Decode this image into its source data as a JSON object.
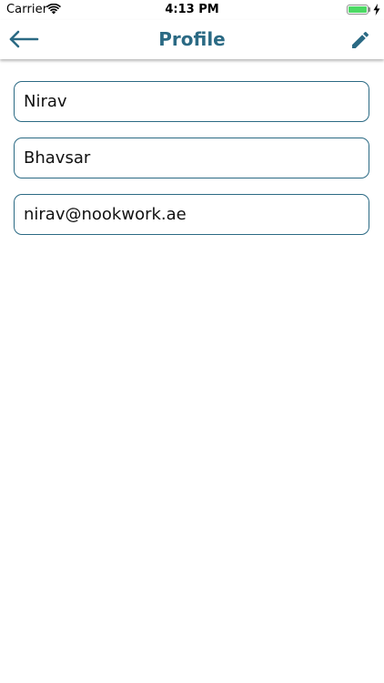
{
  "status_bar": {
    "carrier": "Carrier",
    "time": "4:13 PM",
    "battery_color": "#4cd964"
  },
  "nav": {
    "title": "Profile",
    "back_icon": "back-arrow-icon",
    "edit_icon": "pencil-icon",
    "accent_color": "#2b6a84"
  },
  "form": {
    "first_name": "Nirav",
    "last_name": "Bhavsar",
    "email": "nirav@nookwork.ae"
  }
}
